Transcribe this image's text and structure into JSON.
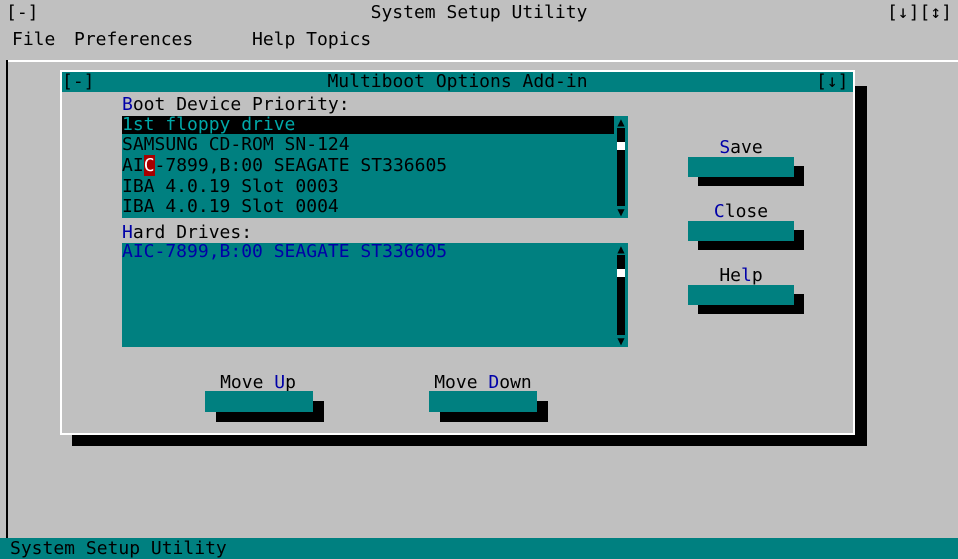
{
  "app": {
    "system_menu": "[-]",
    "title": "System Setup Utility",
    "window_controls": "[↓][↕]"
  },
  "menu": {
    "items": [
      "File",
      "Preferences",
      "Help Topics"
    ]
  },
  "dialog": {
    "system_menu": "[-]",
    "title": "Multiboot Options Add-in",
    "window_controls": "[↓]"
  },
  "boot_priority": {
    "label_first": "B",
    "label_rest": "oot Device Priority:",
    "items": [
      "1st floppy drive",
      "SAMSUNG CD-ROM SN-124",
      "AIC-7899,B:00 SEAGATE ST336605",
      "IBA 4.0.19 Slot 0003",
      "IBA 4.0.19 Slot 0004"
    ],
    "selected_index": 0,
    "focused_item_prefix": "AI",
    "focused_item_cursor": "C",
    "focused_item_suffix": "-7899,B:00 SEAGATE ST336605"
  },
  "hard_drives": {
    "label_first": "H",
    "label_rest": "ard Drives:",
    "items": [
      "AIC-7899,B:00 SEAGATE ST336605"
    ]
  },
  "buttons": {
    "save": {
      "hotkey": "S",
      "rest": "ave"
    },
    "close": {
      "hotkey": "C",
      "rest": "lose"
    },
    "help_prefix": "He",
    "help_hotkey": "l",
    "help_suffix": "p",
    "move_up_prefix": "Move ",
    "move_up_hotkey": "U",
    "move_up_suffix": "p",
    "move_down_prefix": "Move ",
    "move_down_hotkey": "D",
    "move_down_suffix": "own"
  },
  "status_bar": {
    "text": "System Setup Utility"
  },
  "colors": {
    "background": "#c0c0c0",
    "teal": "#008080",
    "hotkey": "#0000a8"
  }
}
